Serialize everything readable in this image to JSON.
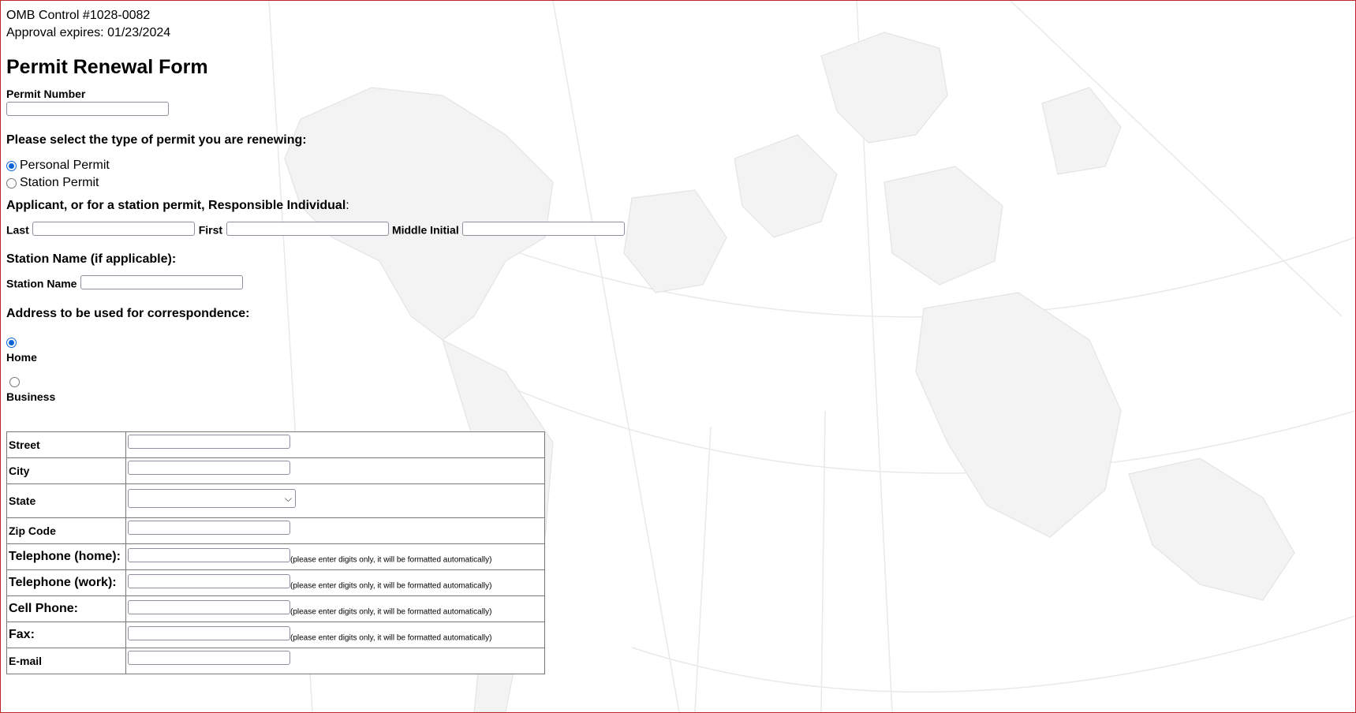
{
  "header": {
    "omb_control": "OMB Control #1028-0082",
    "approval": "Approval expires: 01/23/2024"
  },
  "form": {
    "title": "Permit Renewal Form",
    "permit_number_label": "Permit Number",
    "permit_number_value": "",
    "permit_type_question": "Please select the type of permit you are renewing:",
    "permit_types": [
      {
        "label": "Personal Permit",
        "checked": true
      },
      {
        "label": "Station Permit",
        "checked": false
      }
    ],
    "applicant_heading_bold": "Applicant, or for a station permit, Responsible Individual",
    "applicant_heading_suffix": ":",
    "name_fields": {
      "last_label": "Last",
      "first_label": "First",
      "middle_label": "Middle Initial"
    },
    "station_heading": "Station Name (if applicable):",
    "station_label": "Station Name",
    "address_heading": "Address to be used for correspondence:",
    "address_types": [
      {
        "label": "Home",
        "checked": true
      },
      {
        "label": "Business",
        "checked": false
      }
    ],
    "address_rows": [
      {
        "label": "Street",
        "kind": "text"
      },
      {
        "label": "City",
        "kind": "text"
      },
      {
        "label": "State",
        "kind": "select",
        "selected": ""
      },
      {
        "label": "Zip Code",
        "kind": "text"
      },
      {
        "label": "Telephone (home):",
        "kind": "phone"
      },
      {
        "label": "Telephone (work):",
        "kind": "phone"
      },
      {
        "label": "Cell Phone:",
        "kind": "phone"
      },
      {
        "label": "Fax:",
        "kind": "phone"
      },
      {
        "label": "E-mail",
        "kind": "text"
      }
    ],
    "phone_hint": "(please enter digits only, it will be formatted automatically)"
  },
  "icons": {
    "select_chevron": "chevron-down-icon"
  },
  "colors": {
    "frame_border": "#c0272d",
    "radio_checked": "#0a64d6"
  }
}
